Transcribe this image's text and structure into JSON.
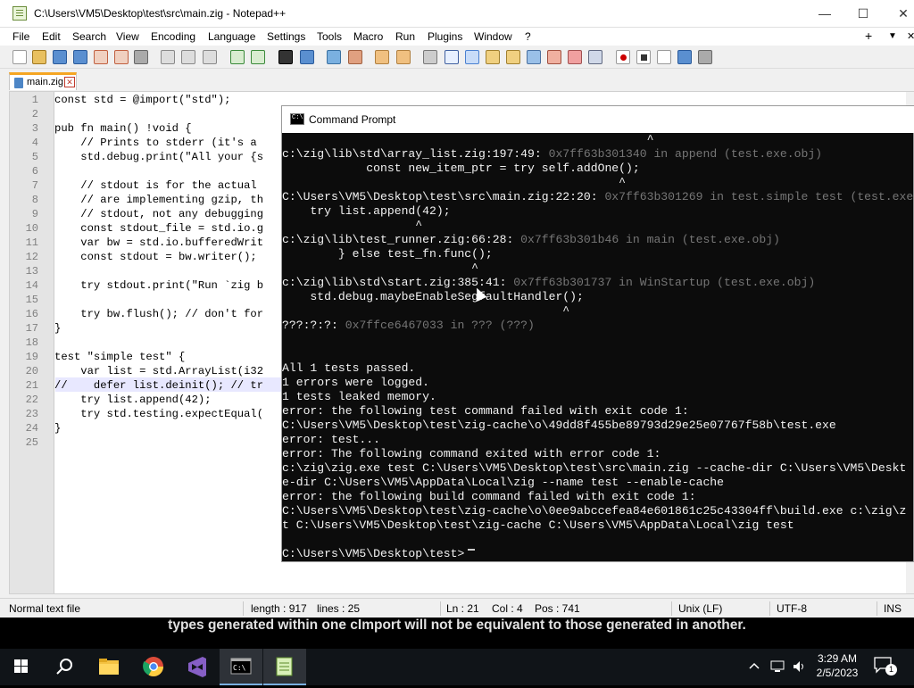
{
  "window_title": "C:\\Users\\VM5\\Desktop\\test\\src\\main.zig - Notepad++",
  "window_controls": {
    "minimize": "—",
    "maximize": "☐",
    "close": "✕"
  },
  "menu": [
    "File",
    "Edit",
    "Search",
    "View",
    "Encoding",
    "Language",
    "Settings",
    "Tools",
    "Macro",
    "Run",
    "Plugins",
    "Window",
    "?"
  ],
  "menu_right": {
    "add": "+",
    "dropdown": "▼",
    "close": "✕"
  },
  "tab": {
    "label": "main.zig",
    "close": "✕"
  },
  "editor": {
    "line_numbers": [
      "1",
      "2",
      "3",
      "4",
      "5",
      "6",
      "7",
      "8",
      "9",
      "10",
      "11",
      "12",
      "13",
      "14",
      "15",
      "16",
      "17",
      "18",
      "19",
      "20",
      "21",
      "22",
      "23",
      "24",
      "25"
    ],
    "lines": [
      "const std = @import(\"std\");",
      "",
      "pub fn main() !void {",
      "    // Prints to stderr (it's a",
      "    std.debug.print(\"All your {s",
      "",
      "    // stdout is for the actual",
      "    // are implementing gzip, th",
      "    // stdout, not any debugging",
      "    const stdout_file = std.io.g",
      "    var bw = std.io.bufferedWrit",
      "    const stdout = bw.writer();",
      "",
      "    try stdout.print(\"Run `zig b",
      "",
      "    try bw.flush(); // don't for",
      "}",
      "",
      "test \"simple test\" {",
      "    var list = std.ArrayList(i32",
      "//    defer list.deinit(); // tr",
      "    try list.append(42);",
      "    try std.testing.expectEqual(",
      "}",
      ""
    ]
  },
  "status": {
    "file_type": "Normal text file",
    "length": "length : 917",
    "lines": "lines : 25",
    "ln": "Ln : 21",
    "col": "Col : 4",
    "pos": "Pos : 741",
    "eol": "Unix (LF)",
    "encoding": "UTF-8",
    "mode": "INS"
  },
  "cmd": {
    "title": "Command Prompt",
    "lines": [
      {
        "a": "                                                    ^",
        "b": ""
      },
      {
        "a": "c:\\zig\\lib\\std\\array_list.zig:197:49:",
        "b": " 0x7ff63b301340 in append (test.exe.obj)"
      },
      {
        "a": "            const new_item_ptr = try self.addOne();",
        "b": ""
      },
      {
        "a": "                                                ^",
        "b": ""
      },
      {
        "a": "C:\\Users\\VM5\\Desktop\\test\\src\\main.zig:22:20:",
        "b": " 0x7ff63b301269 in test.simple test (test.exe"
      },
      {
        "a": "    try list.append(42);",
        "b": ""
      },
      {
        "a": "                   ^",
        "b": ""
      },
      {
        "a": "c:\\zig\\lib\\test_runner.zig:66:28:",
        "b": " 0x7ff63b301b46 in main (test.exe.obj)"
      },
      {
        "a": "        } else test_fn.func();",
        "b": ""
      },
      {
        "a": "                           ^",
        "b": ""
      },
      {
        "a": "c:\\zig\\lib\\std\\start.zig:385:41:",
        "b": " 0x7ff63b301737 in WinStartup (test.exe.obj)"
      },
      {
        "a": "    std.debug.maybeEnableSegfaultHandler();",
        "b": ""
      },
      {
        "a": "                                        ^",
        "b": ""
      },
      {
        "a": "???:?:?:",
        "b": " 0x7ffce6467033 in ??? (???)"
      },
      {
        "a": "",
        "b": ""
      },
      {
        "a": "",
        "b": ""
      },
      {
        "a": "All 1 tests passed.",
        "b": ""
      },
      {
        "a": "1 errors were logged.",
        "b": ""
      },
      {
        "a": "1 tests leaked memory.",
        "b": ""
      },
      {
        "a": "error: the following test command failed with exit code 1:",
        "b": ""
      },
      {
        "a": "C:\\Users\\VM5\\Desktop\\test\\zig-cache\\o\\49dd8f455be89793d29e25e07767f58b\\test.exe",
        "b": ""
      },
      {
        "a": "error: test...",
        "b": ""
      },
      {
        "a": "error: The following command exited with error code 1:",
        "b": ""
      },
      {
        "a": "c:\\zig\\zig.exe test C:\\Users\\VM5\\Desktop\\test\\src\\main.zig --cache-dir C:\\Users\\VM5\\Deskt",
        "b": ""
      },
      {
        "a": "e-dir C:\\Users\\VM5\\AppData\\Local\\zig --name test --enable-cache",
        "b": ""
      },
      {
        "a": "error: the following build command failed with exit code 1:",
        "b": ""
      },
      {
        "a": "C:\\Users\\VM5\\Desktop\\test\\zig-cache\\o\\0ee9abccefea84e601861c25c43304ff\\build.exe c:\\zig\\z",
        "b": ""
      },
      {
        "a": "t C:\\Users\\VM5\\Desktop\\test\\zig-cache C:\\Users\\VM5\\AppData\\Local\\zig test",
        "b": ""
      },
      {
        "a": "",
        "b": ""
      },
      {
        "a": "C:\\Users\\VM5\\Desktop\\test>",
        "b": ""
      }
    ]
  },
  "caption": "types generated within one cImport will not be equivalent to those generated in another.",
  "taskbar": {
    "time": "3:29 AM",
    "date": "2/5/2023",
    "notification_count": "1"
  },
  "colors": {
    "accent": "#3a96dd",
    "tab_accent": "#f5a623",
    "taskbar": "#101418"
  }
}
